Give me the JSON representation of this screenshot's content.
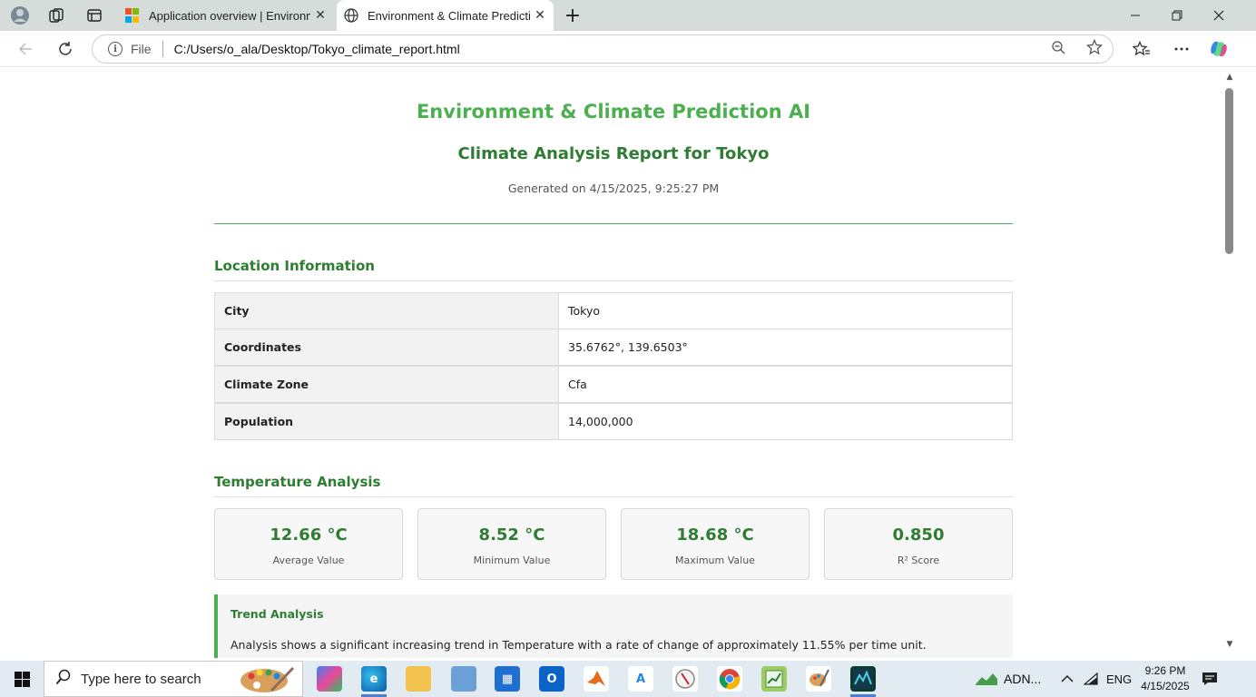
{
  "browser": {
    "tabs": [
      {
        "title": "Application overview | Environme",
        "active": false
      },
      {
        "title": "Environment & Climate Predictior",
        "active": true
      }
    ],
    "address": {
      "scheme_label": "File",
      "url": "C:/Users/o_ala/Desktop/Tokyo_climate_report.html"
    }
  },
  "report": {
    "title": "Environment & Climate Prediction AI",
    "subtitle": "Climate Analysis Report for Tokyo",
    "generated": "Generated on 4/15/2025, 9:25:27 PM",
    "location": {
      "heading": "Location Information",
      "rows": [
        {
          "key": "City",
          "value": "Tokyo"
        },
        {
          "key": "Coordinates",
          "value": "35.6762°, 139.6503°"
        },
        {
          "key": "Climate Zone",
          "value": "Cfa"
        },
        {
          "key": "Population",
          "value": "14,000,000"
        }
      ]
    },
    "temperature": {
      "heading": "Temperature Analysis",
      "stats": [
        {
          "value": "12.66 °C",
          "label": "Average Value"
        },
        {
          "value": "8.52 °C",
          "label": "Minimum Value"
        },
        {
          "value": "18.68 °C",
          "label": "Maximum Value"
        },
        {
          "value": "0.850",
          "label": "R² Score"
        }
      ],
      "trend_title": "Trend Analysis",
      "trend_text": "Analysis shows a significant increasing trend in Temperature with a rate of change of approximately 11.55% per time unit."
    }
  },
  "taskbar": {
    "search_placeholder": "Type here to search",
    "tray_label": "ADN...",
    "language": "ENG",
    "time": "9:26 PM",
    "date": "4/15/2025"
  },
  "colors": {
    "accent": "#4caf50",
    "heading": "#2e7d32"
  }
}
